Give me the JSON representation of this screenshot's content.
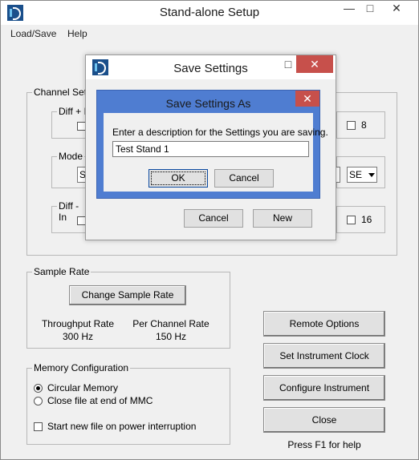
{
  "main_window": {
    "title": "Stand-alone Setup",
    "controls": {
      "minimize": "—",
      "maximize": "□",
      "close": "✕"
    }
  },
  "menu": [
    "Load/Save",
    "Help"
  ],
  "channel_settings": {
    "label": "Channel Setti",
    "diff_plus": "Diff + I",
    "mode": "Mode",
    "mode_left_value": "S",
    "diff_minus": "Diff - In",
    "right_8": "8",
    "right_16": "16",
    "right_select": "SE"
  },
  "sample_rate": {
    "label": "Sample Rate",
    "change_button": "Change Sample Rate",
    "throughput_label": "Throughput Rate",
    "throughput_value": "300 Hz",
    "per_channel_label": "Per Channel Rate",
    "per_channel_value": "150 Hz"
  },
  "memory_config": {
    "label": "Memory Configuration",
    "option_circular": "Circular Memory",
    "option_close_file": "Close file at end of MMC",
    "start_new_file": "Start new file on power interruption"
  },
  "right_buttons": {
    "remote_options": "Remote Options",
    "set_clock": "Set Instrument Clock",
    "configure": "Configure Instrument",
    "close": "Close",
    "help_text": "Press F1 for help"
  },
  "save_settings_dialog": {
    "title": "Save Settings",
    "cancel": "Cancel",
    "new": "New"
  },
  "save_as_dialog": {
    "title": "Save Settings As",
    "prompt": "Enter a description for the Settings you are saving.",
    "description_value": "Test Stand 1",
    "ok": "OK",
    "cancel": "Cancel"
  },
  "colors": {
    "dialog_titlebar": "#4f7dd1",
    "close_red": "#c7504b"
  }
}
